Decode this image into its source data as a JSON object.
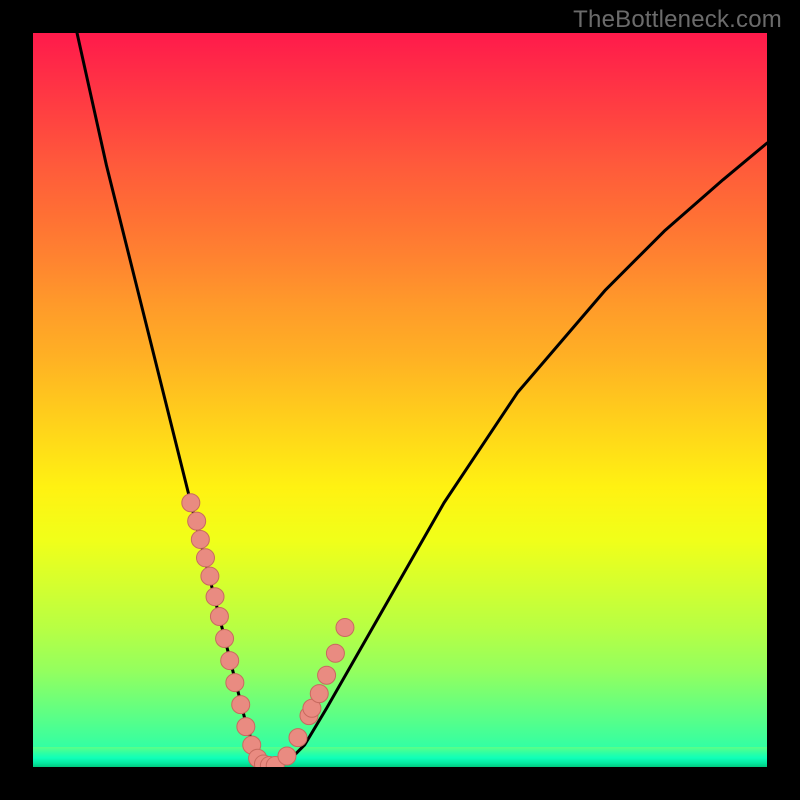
{
  "watermark": "TheBottleneck.com",
  "colors": {
    "bg": "#000000",
    "curve": "#000000",
    "marker_fill": "#e98b81",
    "marker_stroke": "#c86a5f"
  },
  "chart_data": {
    "type": "line",
    "title": "",
    "xlabel": "",
    "ylabel": "",
    "xlim": [
      0,
      100
    ],
    "ylim": [
      0,
      100
    ],
    "series": [
      {
        "name": "curve",
        "x": [
          6,
          8,
          10,
          12,
          14,
          16,
          18,
          20,
          22,
          24,
          25,
          26,
          27,
          28,
          29,
          30,
          31,
          32,
          33,
          35,
          37,
          40,
          44,
          48,
          52,
          56,
          60,
          66,
          72,
          78,
          86,
          94,
          100
        ],
        "y": [
          100,
          91,
          82,
          74,
          66,
          58,
          50,
          42,
          34,
          26,
          22,
          18,
          14,
          10,
          6,
          3,
          1,
          0.3,
          0.2,
          1,
          3,
          8,
          15,
          22,
          29,
          36,
          42,
          51,
          58,
          65,
          73,
          80,
          85
        ]
      }
    ],
    "markers": {
      "name": "dots",
      "x": [
        21.5,
        22.3,
        22.8,
        23.5,
        24.1,
        24.8,
        25.4,
        26.1,
        26.8,
        27.5,
        28.3,
        29.0,
        29.8,
        30.6,
        31.4,
        32.2,
        33.0,
        34.6,
        36.1,
        37.6,
        38.0,
        39.0,
        40.0,
        41.2,
        42.5
      ],
      "y": [
        36.0,
        33.5,
        31.0,
        28.5,
        26.0,
        23.2,
        20.5,
        17.5,
        14.5,
        11.5,
        8.5,
        5.5,
        3.0,
        1.2,
        0.4,
        0.2,
        0.2,
        1.5,
        4.0,
        7.0,
        8.0,
        10.0,
        12.5,
        15.5,
        19.0
      ]
    }
  }
}
